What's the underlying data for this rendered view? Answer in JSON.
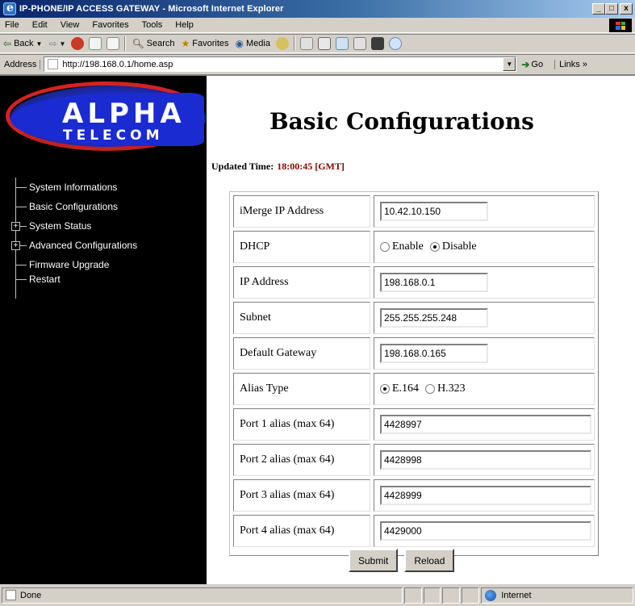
{
  "window": {
    "title": "IP-PHONE/IP ACCESS GATEWAY - Microsoft Internet Explorer",
    "buttons": {
      "minimize": "_",
      "maximize": "□",
      "close": "x"
    }
  },
  "menu": [
    "File",
    "Edit",
    "View",
    "Favorites",
    "Tools",
    "Help"
  ],
  "toolbar": {
    "back": "Back",
    "search": "Search",
    "favorites": "Favorites",
    "media": "Media"
  },
  "address": {
    "label": "Address",
    "url": "http://198.168.0.1/home.asp",
    "go": "Go",
    "links": "Links »"
  },
  "sidebar": {
    "logo": {
      "line1": "ALPHA",
      "line2": "TELECOM"
    },
    "items": [
      {
        "label": "System Informations",
        "expandable": false
      },
      {
        "label": "Basic Configurations",
        "expandable": false
      },
      {
        "label": "System Status",
        "expandable": true
      },
      {
        "label": "Advanced Configurations",
        "expandable": true
      },
      {
        "label": "Firmware Upgrade",
        "expandable": false
      },
      {
        "label": "Restart",
        "expandable": false
      }
    ]
  },
  "main": {
    "title": "Basic Configurations",
    "updated_label": "Updated Time:",
    "updated_time": "18:00:45 [GMT]",
    "fields": {
      "imerge": {
        "label": "iMerge IP Address",
        "value": "10.42.10.150"
      },
      "dhcp": {
        "label": "DHCP",
        "enable": "Enable",
        "disable": "Disable",
        "selected": "Disable"
      },
      "ip": {
        "label": "IP Address",
        "value": "198.168.0.1"
      },
      "subnet": {
        "label": "Subnet",
        "value": "255.255.255.248"
      },
      "gateway": {
        "label": "Default Gateway",
        "value": "198.168.0.165"
      },
      "alias_type": {
        "label": "Alias Type",
        "opt1": "E.164",
        "opt2": "H.323",
        "selected": "E.164"
      },
      "port1": {
        "label": "Port 1 alias (max 64)",
        "value": "4428997"
      },
      "port2": {
        "label": "Port 2 alias (max 64)",
        "value": "4428998"
      },
      "port3": {
        "label": "Port 3 alias (max 64)",
        "value": "4428999"
      },
      "port4": {
        "label": "Port 4 alias (max 64)",
        "value": "4429000"
      }
    },
    "submit": "Submit",
    "reload": "Reload"
  },
  "status": {
    "text": "Done",
    "zone": "Internet"
  },
  "colors": {
    "title_bar": "#0a246a",
    "sidebar_bg": "#000000",
    "logo_blue": "#1a2bd1",
    "logo_red": "#d42222",
    "time_color": "#8b0000"
  }
}
